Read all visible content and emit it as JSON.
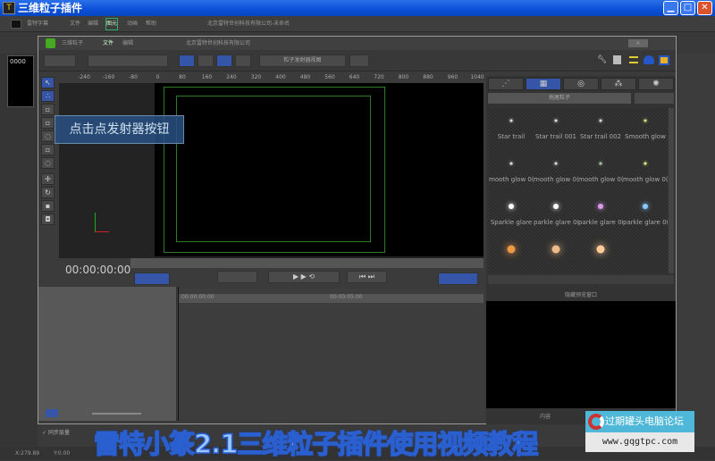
{
  "window": {
    "title": "三维粒子插件",
    "app_icon": "T",
    "minimize": "▁",
    "maximize": "□",
    "close": "✕"
  },
  "host": {
    "menu": [
      "雷特字幕",
      "文件",
      "编辑",
      "图元",
      "动画",
      "帮助"
    ],
    "company": "北京雷特世创科技有限公司-未命名",
    "clip_label": "0000"
  },
  "plugin": {
    "title": "三维粒子",
    "menu": [
      "文件",
      "编辑"
    ],
    "company": "北京雷特世创科技有限公司",
    "view_select": "粒子发射器视图",
    "close": "✕"
  },
  "ruler": [
    "-240",
    "-160",
    "-80",
    "0",
    "80",
    "160",
    "240",
    "320",
    "400",
    "480",
    "560",
    "640",
    "720",
    "800",
    "880",
    "960",
    "1040"
  ],
  "tooltip": "点击点发射器按钮",
  "timecode": "00:00:00:00",
  "timeline": {
    "start": "00:00:00:00",
    "mark": "00:00:05:00",
    "sync_label": "同步层量"
  },
  "panel": {
    "tabs": [
      "粒子",
      "预设",
      "发射",
      "力场",
      "灯光"
    ],
    "preset_category": "拖尾粒子",
    "presets": [
      "Star trail",
      "Star trail 001",
      "Star trail 002",
      "Smooth glow",
      "mooth glow 0(",
      "mooth glow 0(",
      "mooth glow 0(",
      "mooth glow 0(",
      "Sparkle glare",
      "parkle glare 0(",
      "parkle glare 0(",
      "parkle glare 0(",
      "",
      "",
      "",
      ""
    ],
    "preset_colors": [
      "#ddd",
      "#ddd",
      "#ddd",
      "#dd8",
      "#ddd",
      "#ddd",
      "#aca",
      "#ee8",
      "#fff",
      "#fff",
      "#d9e",
      "#8cf",
      "#e94",
      "#eb8",
      "#fc9",
      ""
    ],
    "preview_label": "隐藏预览窗口",
    "content_label": "内容"
  },
  "status": {
    "x": "X:279.89",
    "y": "Y:0.00"
  },
  "caption": "雷特小篆2.1三维粒子插件使用视频教程",
  "watermark": {
    "name": "过期罐头电脑论坛",
    "url": "www.gqgtpc.com"
  }
}
